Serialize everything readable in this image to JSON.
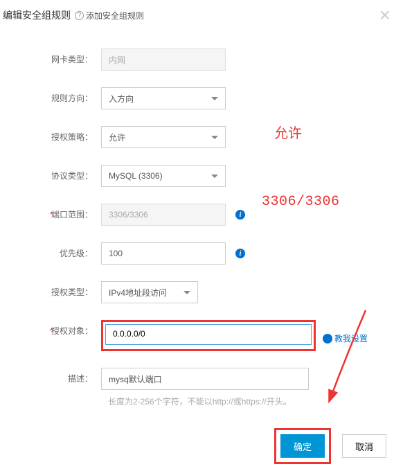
{
  "header": {
    "title": "编辑安全组规则",
    "subtitle": "添加安全组规则",
    "help_glyph": "?",
    "close_glyph": "×"
  },
  "fields": {
    "nic_type": {
      "label": "网卡类型：",
      "value": "内网"
    },
    "direction": {
      "label": "规则方向：",
      "value": "入方向"
    },
    "policy": {
      "label": "授权策略：",
      "value": "允许"
    },
    "protocol": {
      "label": "协议类型：",
      "value": "MySQL (3306)"
    },
    "port": {
      "label": "端口范围：",
      "value": "3306/3306"
    },
    "priority": {
      "label": "优先级：",
      "value": "100"
    },
    "auth_type": {
      "label": "授权类型：",
      "value": "IPv4地址段访问"
    },
    "auth_object": {
      "label": "授权对象：",
      "value": "0.0.0.0/0",
      "help_link": "教我设置"
    },
    "description": {
      "label": "描述：",
      "value": "mysq默认端口",
      "hint": "长度为2-256个字符，不能以http://或https://开头。"
    }
  },
  "info_glyph": "i",
  "annotations": {
    "policy": "允许",
    "port": "3306/3306"
  },
  "buttons": {
    "ok": "确定",
    "cancel": "取消"
  }
}
